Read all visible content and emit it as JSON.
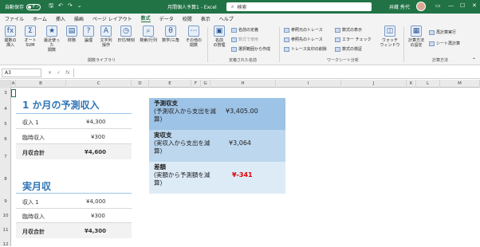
{
  "titlebar": {
    "autosave_label": "自動保存",
    "autosave_state": "オフ",
    "doc_title": "月間個人予算1 - Excel",
    "search_placeholder": "検索",
    "user_name": "井蔵 秀代",
    "colors": {
      "brand": "#217346"
    }
  },
  "menu": {
    "tabs": [
      "ファイル",
      "ホーム",
      "挿入",
      "描画",
      "ページ レイアウト",
      "数式",
      "データ",
      "校閲",
      "表示",
      "ヘルプ"
    ],
    "active": "数式"
  },
  "ribbon": {
    "insert_function": "関数の\n挿入",
    "autosum": "オート\nSUM",
    "recent": "最近使った\n関数",
    "financial": "財務",
    "logical": "論理",
    "text": "文字列\n操作",
    "datetime": "日付/時刻",
    "lookup": "検索/行列",
    "math": "数学/三角",
    "more": "その他の\n関数",
    "group_library": "関数ライブラリ",
    "name_manager": "名前\nの管理",
    "define_name": "名前の定義",
    "use_in_formula": "数式で使用",
    "create_from_sel": "選択範囲から作成",
    "group_names": "定義された名前",
    "trace_precedents": "参照元のトレース",
    "trace_dependents": "参照先のトレース",
    "remove_arrows": "トレース矢印の削除",
    "show_formulas": "数式の表示",
    "error_check": "エラー チェック",
    "evaluate": "数式の検証",
    "group_audit": "ワークシート分析",
    "watch": "ウォッチ\nウィンドウ",
    "calc_options": "計算方法\nの設定",
    "calc_now": "再計算実行",
    "calc_sheet": "シート再計算",
    "group_calc": "計算方法"
  },
  "formula": {
    "name_box": "A3",
    "fx": "fx",
    "cancel": "✕",
    "enter": "✓",
    "content": ""
  },
  "columns": [
    "A",
    "B",
    "C",
    "D",
    "E",
    "F",
    "G",
    "H",
    "I",
    "J",
    "K",
    "L",
    "M"
  ],
  "rows": [
    "3",
    "4",
    "5",
    "6",
    "7",
    "8",
    "9",
    "10",
    "11",
    "12"
  ],
  "sheet": {
    "projected": {
      "title": "1 か月の予測収入",
      "rows": [
        {
          "label": "収入 1",
          "value": "¥4,300"
        },
        {
          "label": "臨時収入",
          "value": "¥300"
        }
      ],
      "total_label": "月収合計",
      "total_value": "¥4,600"
    },
    "actual": {
      "title": "実月収",
      "rows": [
        {
          "label": "収入 1",
          "value": "¥4,000"
        },
        {
          "label": "臨時収入",
          "value": "¥300"
        }
      ],
      "total_label": "月収合計",
      "total_value": "¥4,300"
    },
    "balance": {
      "projected_title": "予測収支",
      "projected_desc": "(予測収入から支出を減算)",
      "projected_value": "¥3,405.00",
      "actual_title": "実収支",
      "actual_desc": "(実収入から支出を減算)",
      "actual_value": "¥3,064",
      "diff_title": "差額",
      "diff_desc": "(実額から予測額を減算)",
      "diff_value": "¥-341",
      "colors": {
        "row1": "#9dc3e6",
        "row2": "#bdd7ee",
        "row3": "#ddebf7",
        "negative": "#e00000",
        "title_blue": "#2e75b6"
      }
    }
  }
}
